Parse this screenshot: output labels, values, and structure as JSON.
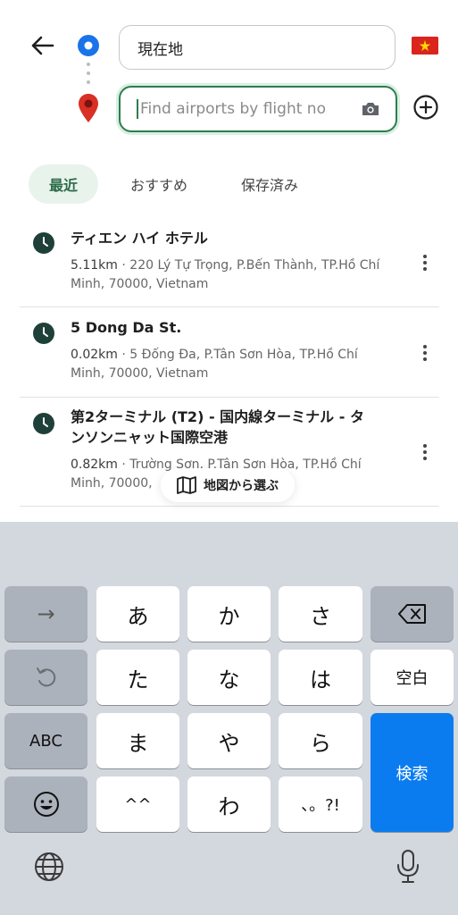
{
  "search": {
    "origin_value": "現在地",
    "destination_placeholder": "Find airports by flight no"
  },
  "tabs": [
    {
      "label": "最近",
      "active": true
    },
    {
      "label": "おすすめ",
      "active": false
    },
    {
      "label": "保存済み",
      "active": false
    }
  ],
  "results": [
    {
      "title": "ティエン ハイ ホテル",
      "distance": "5.11km",
      "address_line1": "220 Lý Tự Trọng, P.Bến Thành, TP.Hồ Chí",
      "address_line2": "Minh, 70000, Vietnam"
    },
    {
      "title": "5 Dong Da St.",
      "distance": "0.02km",
      "address_line1": "5 Đống Đa, P.Tân Sơn Hòa, TP.Hồ Chí",
      "address_line2": "Minh, 70000, Vietnam"
    },
    {
      "title_line1": "第2ターミナル (T2) - 国内線ターミナル - タ",
      "title_line2": "ンソンニャット国際空港",
      "distance": "0.82km",
      "address_line1": "Trường Sơn, P.Tân Sơn Hòa, TP.Hồ Chí",
      "address_line2": "Minh, 70000,"
    }
  ],
  "map_select_label": "地図から選ぶ",
  "keyboard": {
    "row1": [
      "→",
      "あ",
      "か",
      "さ"
    ],
    "row2": [
      "た",
      "な",
      "は",
      "空白"
    ],
    "row3": [
      "ABC",
      "ま",
      "や",
      "ら",
      "検索"
    ],
    "row4": [
      "^^",
      "わ",
      "、。?!"
    ]
  },
  "colors": {
    "accent_green": "#2e7d4f",
    "origin_blue": "#1a73e8",
    "pin_red": "#d93025",
    "keyboard_bg": "#d3d7de",
    "search_key_blue": "#0a7cf0"
  },
  "icons": [
    "back-arrow-icon",
    "origin-dot-icon",
    "destination-pin-icon",
    "camera-icon",
    "flag-vietnam-icon",
    "add-stop-icon",
    "clock-icon",
    "more-vert-icon",
    "map-icon",
    "backspace-icon",
    "undo-icon",
    "emoji-icon",
    "globe-icon",
    "microphone-icon"
  ]
}
